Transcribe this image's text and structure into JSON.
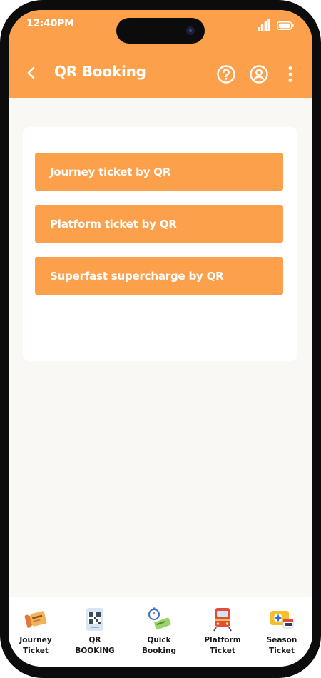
{
  "status_bar": {
    "time": "12:40PM"
  },
  "app_bar": {
    "title": "QR Booking",
    "back_icon": "chevron-left-icon",
    "help_icon": "help-circle-icon",
    "profile_icon": "user-circle-icon",
    "menu_icon": "more-vertical-icon"
  },
  "colors": {
    "accent": "#fda04b",
    "background": "#f9f8f4",
    "card": "#ffffff"
  },
  "options": [
    {
      "label": "Journey ticket by QR"
    },
    {
      "label": "Platform ticket by QR"
    },
    {
      "label": "Superfast supercharge by QR"
    }
  ],
  "bottom_nav": [
    {
      "label_line1": "Journey",
      "label_line2": "Ticket",
      "icon": "ticket-icon"
    },
    {
      "label_line1": "QR",
      "label_line2": "BOOKING",
      "icon": "qr-code-icon"
    },
    {
      "label_line1": "Quick",
      "label_line2": "Booking",
      "icon": "stopwatch-ticket-icon"
    },
    {
      "label_line1": "Platform",
      "label_line2": "Ticket",
      "icon": "train-icon"
    },
    {
      "label_line1": "Season",
      "label_line2": "Ticket",
      "icon": "season-calendar-icon"
    }
  ]
}
